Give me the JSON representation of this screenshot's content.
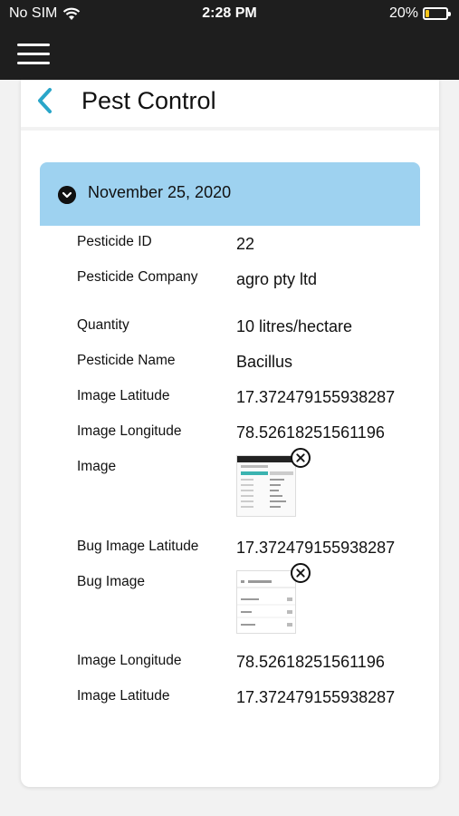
{
  "status_bar": {
    "carrier": "No SIM",
    "time": "2:28 PM",
    "battery_percent": "20%",
    "battery_level": 0.2,
    "battery_color": "#f5c518"
  },
  "nav": {
    "menu_icon": "hamburger-icon"
  },
  "header": {
    "title": "Pest Control",
    "back_icon": "chevron-left-icon"
  },
  "record": {
    "date": "November 25, 2020",
    "accent_color": "#9ed2f0",
    "fields": [
      {
        "label": "Pesticide ID",
        "value": "22"
      },
      {
        "label": "Pesticide Company",
        "value": "agro pty ltd"
      },
      {
        "label": "Quantity",
        "value": "10 litres/hectare"
      },
      {
        "label": "Pesticide Name",
        "value": "Bacillus"
      },
      {
        "label": "Image Latitude",
        "value": "17.372479155938287"
      },
      {
        "label": "Image Longitude",
        "value": "78.52618251561196"
      },
      {
        "label": "Image",
        "value": ""
      },
      {
        "label": "Bug Image Latitude",
        "value": "17.372479155938287"
      },
      {
        "label": "Bug Image",
        "value": ""
      },
      {
        "label": "Image Longitude",
        "value": "78.52618251561196"
      },
      {
        "label": "Image Latitude",
        "value": "17.372479155938287"
      }
    ]
  }
}
